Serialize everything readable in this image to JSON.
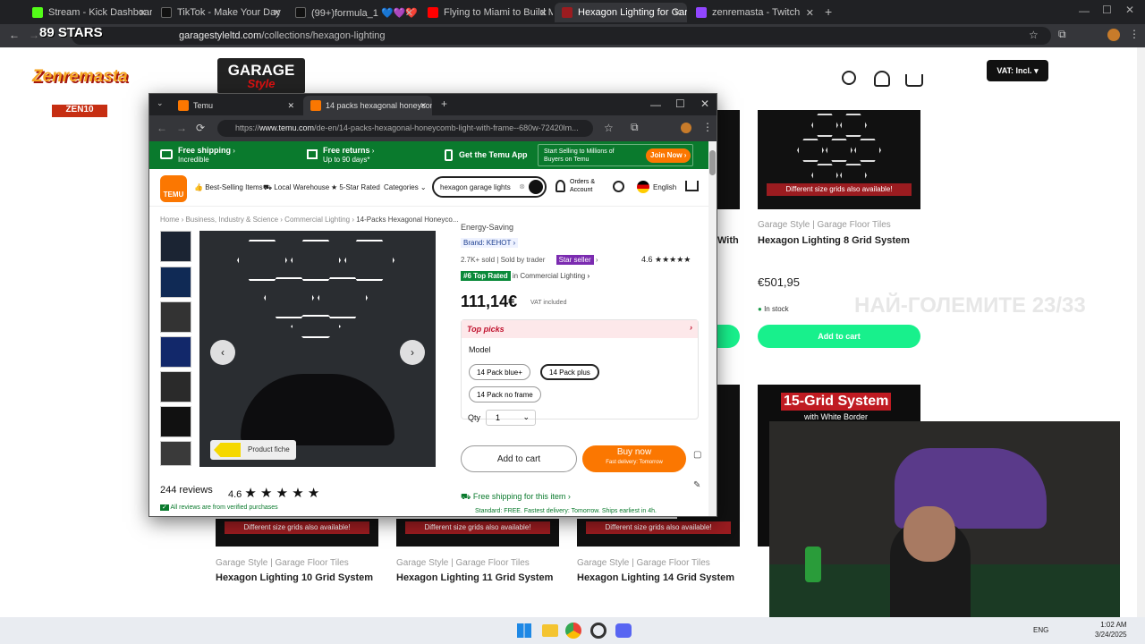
{
  "outer_tabs": [
    {
      "label": "Stream - Kick Dashboard",
      "color": "#53fc18"
    },
    {
      "label": "TikTok - Make Your Day",
      "color": "#111111"
    },
    {
      "label": "(99+)formula_1 💙💜❤️ (@re",
      "color": "#111111"
    },
    {
      "label": "Flying to Miami to Build Mat A",
      "color": "#ff0000"
    },
    {
      "label": "Hexagon Lighting for Garage, C",
      "color": "#9b1c20"
    },
    {
      "label": "zenremasta - Twitch",
      "color": "#9146ff"
    }
  ],
  "outer_url": {
    "host": "garagestyleltd.com",
    "path": "/collections/hexagon-lighting"
  },
  "overlay": {
    "logo": "Zenremasta",
    "sub": "ZEN10",
    "stars": "89 STARS",
    "watermark": "НАЙ-ГОЛЕМИТЕ 23/33"
  },
  "garage": {
    "logo_line1": "GARAGE",
    "logo_line2": "Style",
    "vat": "VAT: Incl.",
    "products_top": [
      {
        "cat": "Garage Style | Garage Floor Tiles",
        "title": "Hexagon Lighting 8 Grid System",
        "price": "€501,95",
        "stock": "In stock",
        "cta": "Add to cart",
        "banner": "Different size grids also available!"
      }
    ],
    "partial_title": "With",
    "grid15": {
      "title": "15-Grid System",
      "sub": "with White Border"
    },
    "products_bottom": [
      {
        "cat": "Garage Style | Garage Floor Tiles",
        "title": "Hexagon Lighting 10 Grid System",
        "banner": "Different size grids also available!"
      },
      {
        "cat": "Garage Style | Garage Floor Tiles",
        "title": "Hexagon Lighting 11 Grid System",
        "banner": "Different size grids also available!"
      },
      {
        "cat": "Garage Style | Garage Floor Tiles",
        "title": "Hexagon Lighting 14 Grid System",
        "banner": "Different size grids also available!"
      }
    ]
  },
  "inner_tabs": [
    {
      "label": "Temu"
    },
    {
      "label": "14 packs hexagonal honeycom"
    }
  ],
  "inner_url": {
    "scheme": "https://",
    "host": "www.temu.com",
    "path": "/de-en/14-packs-hexagonal-honeycomb-light-with-frame--680w-72420lm..."
  },
  "promo": {
    "ship": "Free shipping",
    "ship_sub": "Incredible",
    "returns": "Free returns",
    "returns_sub": "Up to 90 days*",
    "app": "Get the Temu App",
    "sell": "Start Selling to Millions of Buyers on Temu",
    "join": "Join Now"
  },
  "nav": {
    "brand": "TEMU",
    "best": "Best-Selling Items",
    "local": "Local Warehouse",
    "rated": "5-Star Rated",
    "categories": "Categories",
    "search": "hexagon garage lights",
    "orders": "Orders & Account",
    "lang": "English"
  },
  "breadcrumb": [
    "Home",
    "Business, Industry & Science",
    "Commercial Lighting",
    "14-Packs Hexagonal Honeyco..."
  ],
  "product": {
    "subtitle": "Energy-Saving",
    "brand": "Brand: KEHOT",
    "sold": "2.7K+ sold",
    "seller": "Sold by trader",
    "star_seller": "Star seller",
    "rating": "4.6",
    "top_rated": "#6 Top Rated",
    "in_category": "in Commercial Lighting",
    "price": "111,14€",
    "vat": "VAT included",
    "top_picks": "Top picks",
    "model_label": "Model",
    "models": [
      "14 Pack blue+",
      "14 Pack plus",
      "14 Pack no frame"
    ],
    "qty_label": "Qty",
    "qty": "1",
    "add_cart": "Add to cart",
    "buy_now": "Buy now",
    "fast": "Fast delivery: Tomorrow",
    "free_ship": "Free shipping for this item",
    "ship_detail": "Standard: FREE. Fastest delivery: Tomorrow. Ships earliest in 4h.",
    "reviews": "244 reviews",
    "review_rating": "4.6",
    "verified": "All reviews are from verified purchases",
    "fiche": "Product fiche"
  },
  "taskbar": {
    "lang": "ENG",
    "time": "1:02 AM",
    "date": "3/24/2025"
  }
}
